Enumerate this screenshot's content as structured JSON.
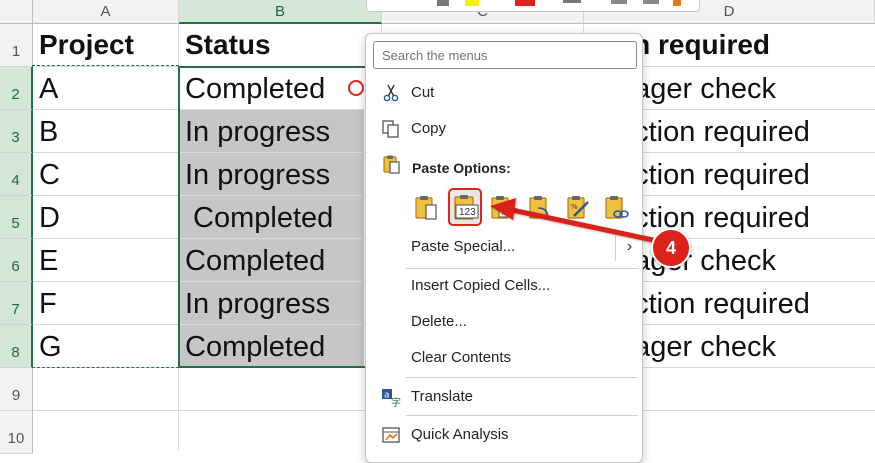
{
  "columns": [
    "A",
    "B",
    "C",
    "D"
  ],
  "rows": [
    "1",
    "2",
    "3",
    "4",
    "5",
    "6",
    "7",
    "8",
    "9",
    "10"
  ],
  "headers": {
    "project": "Project",
    "status": "Status",
    "action_partial": "on required"
  },
  "projects": [
    "A",
    "B",
    "C",
    "D",
    "E",
    "F",
    "G"
  ],
  "statuses": [
    "Completed",
    "In progress",
    "In progress",
    " Completed",
    "Completed",
    "In progress",
    "Completed"
  ],
  "actions_partial": [
    "nager check",
    "action required",
    "action required",
    "action required",
    "nager check",
    "action required",
    "nager check"
  ],
  "context_menu": {
    "search_placeholder": "Search the menus",
    "cut": "Cut",
    "copy": "Copy",
    "paste_options": "Paste Options:",
    "paste_special": "Paste Special...",
    "insert_copied_cells": "Insert Copied Cells...",
    "delete": "Delete...",
    "clear_contents": "Clear Contents",
    "translate": "Translate",
    "quick_analysis": "Quick Analysis",
    "paste_values_icon_text": "123"
  },
  "annotation": {
    "step": "4",
    "color": "#d9231b"
  },
  "colors": {
    "excel_green": "#217346",
    "selection_fill": "#c6c6c6"
  }
}
